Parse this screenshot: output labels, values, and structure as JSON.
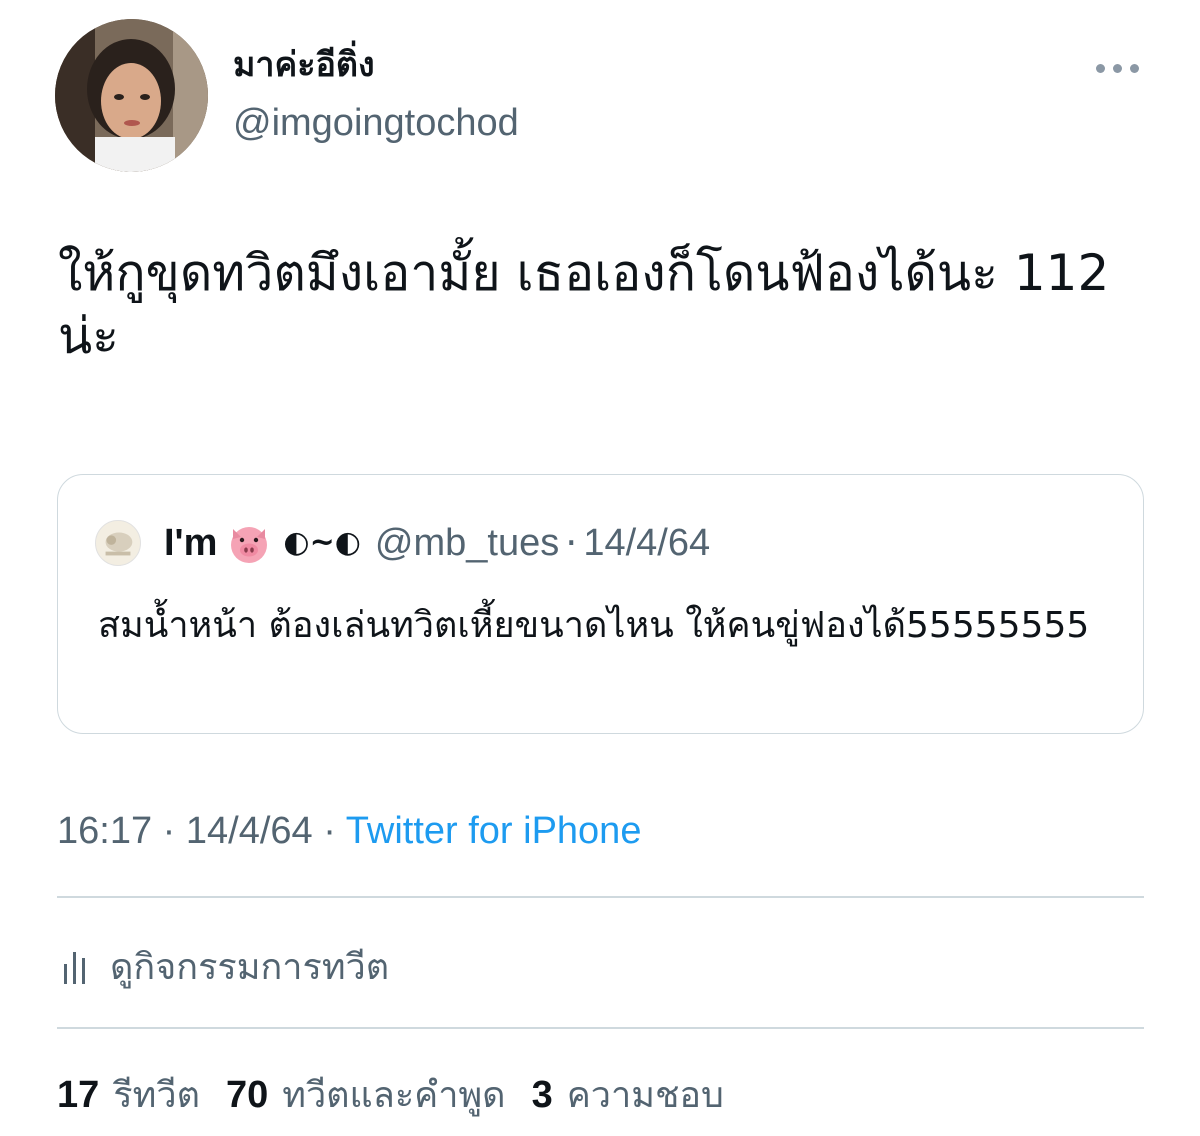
{
  "author": {
    "display_name": "มาค่ะอีติ่ง",
    "handle": "@imgoingtochod"
  },
  "tweet": {
    "text": "ให้กูขุดทวิตมึงเอามั้ย เธอเองก็โดนฟ้องได้นะ 112 น่ะ"
  },
  "quoted_tweet": {
    "name": "I'm",
    "emoji_icon": "pig-face-icon",
    "name_suffix": "◐~◐",
    "handle": "@mb_tues",
    "separator": "·",
    "date": "14/4/64",
    "text": "สมน้ำหน้า ต้องเล่นทวิตเหี้ยขนาดไหน ให้คนขู่ฟองได้55555555"
  },
  "meta": {
    "time": "16:17",
    "separator": "·",
    "date": "14/4/64",
    "source": "Twitter for iPhone"
  },
  "activity": {
    "icon": "analytics-bars-icon",
    "label": "ดูกิจกรรมการทวีต"
  },
  "stats": {
    "retweets_count": "17",
    "retweets_label": "รีทวีต",
    "quotes_count": "70",
    "quotes_label": "ทวีตและคำพูด",
    "likes_count": "3",
    "likes_label": "ความชอบ"
  },
  "colors": {
    "text_primary": "#0f1419",
    "text_secondary": "#536471",
    "link": "#1d9bf0",
    "border": "#cfd9de"
  }
}
